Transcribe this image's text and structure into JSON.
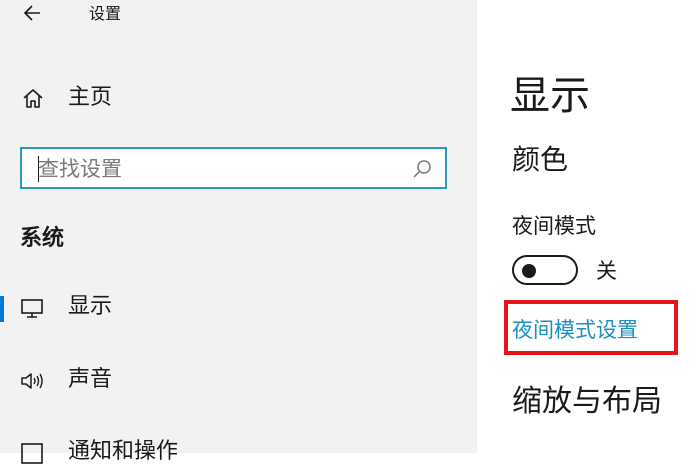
{
  "window": {
    "title": "设置"
  },
  "sidebar": {
    "home_label": "主页",
    "search_placeholder": "查找设置",
    "section_title": "系统",
    "items": [
      {
        "label": "显示",
        "icon": "monitor-icon",
        "selected": true
      },
      {
        "label": "声音",
        "icon": "speaker-icon",
        "selected": false
      },
      {
        "label": "通知和操作",
        "icon": "notification-icon",
        "selected": false
      }
    ]
  },
  "main": {
    "page_title": "显示",
    "color_heading": "颜色",
    "night_mode_label": "夜间模式",
    "night_mode_state": "关",
    "night_mode_on": false,
    "night_mode_settings_link": "夜间模式设置",
    "scale_layout_heading": "缩放与布局"
  },
  "colors": {
    "sidebar_bg": "#f2f2f2",
    "accent": "#0078d7",
    "search_border": "#2d9bb7",
    "link": "#1b8ec2",
    "highlight_box": "#e8141b"
  }
}
